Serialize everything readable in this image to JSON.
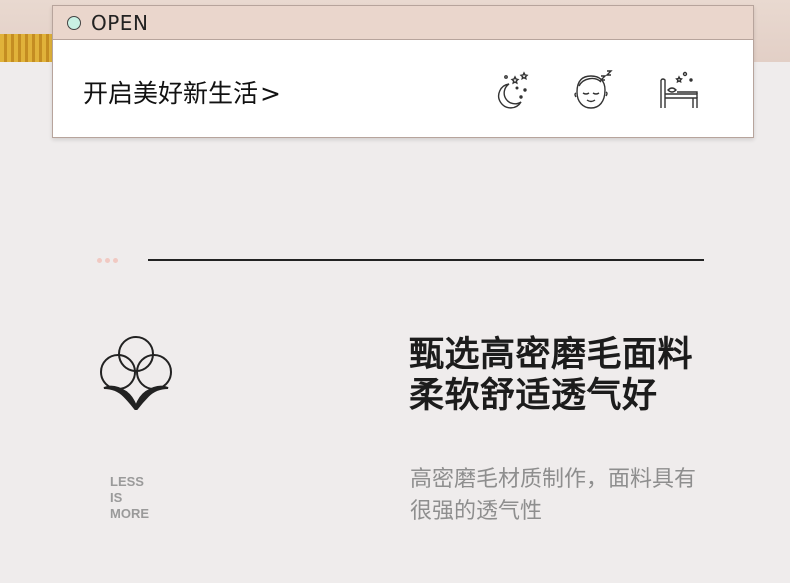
{
  "card": {
    "status_label": "OPEN",
    "slogan": "开启美好新生活",
    "slogan_chevron": ">",
    "icons": [
      "moon-stars-icon",
      "sleeping-face-icon",
      "bed-icon"
    ]
  },
  "feature": {
    "headline_line1": "甄选高密磨毛面料",
    "headline_line2": "柔软舒适透气好",
    "desc_line1": "高密磨毛材质制作，面料具有",
    "desc_line2": "很强的透气性",
    "motto": [
      "LESS",
      "IS",
      "MORE"
    ],
    "icon": "cotton-flower-icon"
  },
  "colors": {
    "background": "#efecec",
    "header_band": "#ead6cc",
    "status_dot": "#c9f1e4",
    "divider_dots": "#f1c9c2"
  }
}
